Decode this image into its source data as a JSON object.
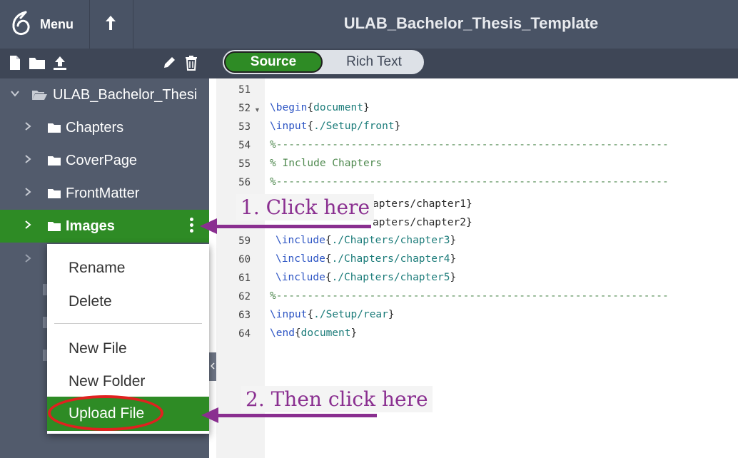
{
  "topbar": {
    "menu_label": "Menu",
    "project_title": "ULAB_Bachelor_Thesis_Template"
  },
  "editor_toggle": {
    "source_label": "Source",
    "rich_text_label": "Rich Text"
  },
  "file_tree": {
    "root_label": "ULAB_Bachelor_Thesi",
    "items": [
      {
        "label": "Chapters"
      },
      {
        "label": "CoverPage"
      },
      {
        "label": "FrontMatter"
      },
      {
        "label": "Images"
      }
    ]
  },
  "context_menu": {
    "rename": "Rename",
    "delete": "Delete",
    "new_file": "New File",
    "new_folder": "New Folder",
    "upload_file": "Upload File"
  },
  "editor": {
    "lines": [
      {
        "n": "51"
      },
      {
        "n": "52"
      },
      {
        "n": "53"
      },
      {
        "n": "54"
      },
      {
        "n": "55"
      },
      {
        "n": "56"
      },
      {
        "n": "57"
      },
      {
        "n": "58"
      },
      {
        "n": "59"
      },
      {
        "n": "60"
      },
      {
        "n": "61"
      },
      {
        "n": "62"
      },
      {
        "n": "63"
      },
      {
        "n": "64"
      }
    ],
    "code": {
      "begin_cmd": "\\begin",
      "begin_arg": "document",
      "input_cmd": "\\input",
      "front_arg": "./Setup/front",
      "rule": "%---------------------------------------------------------------",
      "include_comment": "% Include Chapters",
      "partial_57": "apters/chapter1}",
      "partial_58": "apters/chapter2}",
      "include_cmd": "\\include",
      "ch3": "./Chapters/chapter3",
      "ch4": "./Chapters/chapter4",
      "ch5": "./Chapters/chapter5",
      "rear_arg": "./Setup/rear",
      "end_cmd": "\\end",
      "end_arg": "document"
    }
  },
  "annotations": {
    "step1": "1. Click here",
    "step2": "2. Then click here"
  },
  "colors": {
    "accent_green": "#2e8b25",
    "annotation_purple": "#8a2f90",
    "highlight_red": "#e0211f"
  }
}
